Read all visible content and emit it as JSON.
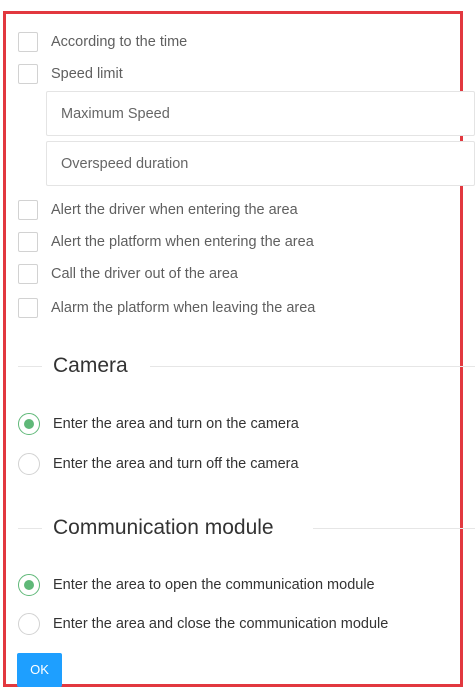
{
  "checkboxes_top": [
    {
      "label": "According to the time",
      "checked": false
    },
    {
      "label": "Speed limit",
      "checked": false
    }
  ],
  "speed_fields": {
    "max_speed_placeholder": "Maximum Speed",
    "overspeed_placeholder": "Overspeed duration"
  },
  "checkboxes_alerts": [
    {
      "label": "Alert the driver when entering the area",
      "checked": false
    },
    {
      "label": "Alert the platform when entering the area",
      "checked": false
    },
    {
      "label": "Call the driver out of the area",
      "checked": false
    },
    {
      "label": "Alarm the platform when leaving the area",
      "checked": false
    }
  ],
  "camera": {
    "title": "Camera",
    "options": [
      {
        "label": "Enter the area and turn on the camera",
        "selected": true
      },
      {
        "label": "Enter the area and turn off the camera",
        "selected": false
      }
    ]
  },
  "communication": {
    "title": "Communication module",
    "options": [
      {
        "label": "Enter the area to open the communication module",
        "selected": true
      },
      {
        "label": "Enter the area and close the communication module",
        "selected": false
      }
    ]
  },
  "ok_label": "OK",
  "colors": {
    "frame": "#e2383f",
    "radio_selected": "#5fb878",
    "button": "#1e9fff"
  }
}
